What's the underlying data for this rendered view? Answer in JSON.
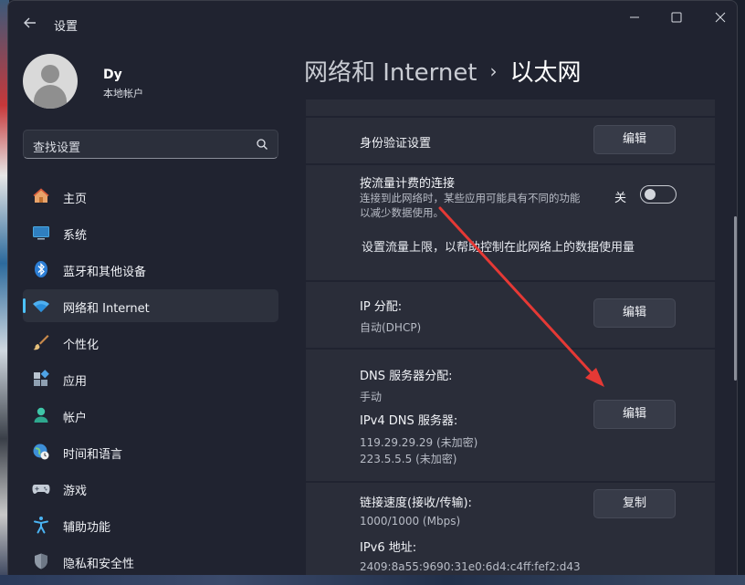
{
  "window": {
    "title": "设置"
  },
  "profile": {
    "name": "Dy",
    "account_type": "本地帐户"
  },
  "search": {
    "placeholder": "查找设置"
  },
  "nav": [
    {
      "label": "主页",
      "icon": "home-icon"
    },
    {
      "label": "系统",
      "icon": "monitor-icon"
    },
    {
      "label": "蓝牙和其他设备",
      "icon": "bluetooth-icon"
    },
    {
      "label": "网络和 Internet",
      "icon": "wifi-icon",
      "active": true
    },
    {
      "label": "个性化",
      "icon": "brush-icon"
    },
    {
      "label": "应用",
      "icon": "apps-icon"
    },
    {
      "label": "帐户",
      "icon": "account-icon"
    },
    {
      "label": "时间和语言",
      "icon": "globe-clock-icon"
    },
    {
      "label": "游戏",
      "icon": "gamepad-icon"
    },
    {
      "label": "辅助功能",
      "icon": "accessibility-icon"
    },
    {
      "label": "隐私和安全性",
      "icon": "shield-icon"
    }
  ],
  "breadcrumb": {
    "parent": "网络和 Internet",
    "separator": "›",
    "current": "以太网"
  },
  "auth": {
    "label": "身份验证设置",
    "button": "编辑"
  },
  "metered": {
    "label": "按流量计费的连接",
    "desc_line1": "连接到此网络时，某些应用可能具有不同的功能",
    "desc_line2": "以减少数据使用。",
    "toggle_state": "关",
    "toggle_on": false,
    "data_limit_link": "设置流量上限，以帮助控制在此网络上的数据使用量"
  },
  "ip": {
    "label": "IP 分配:",
    "value": "自动(DHCP)",
    "button": "编辑"
  },
  "dns": {
    "label": "DNS 服务器分配:",
    "value": "手动",
    "ipv4_label": "IPv4 DNS 服务器:",
    "server1": "119.29.29.29 (未加密)",
    "server2": "223.5.5.5 (未加密)",
    "button": "编辑"
  },
  "link": {
    "speed_label": "链接速度(接收/传输):",
    "speed_value": "1000/1000 (Mbps)",
    "ipv6_label": "IPv6 地址:",
    "ipv6_value": "2409:8a55:9690:31e0:6d4:c4ff:fef2:d43",
    "button": "复制"
  },
  "colors": {
    "accent": "#4cc2ff",
    "annotation_arrow": "#e53935",
    "window_bg": "#202330",
    "card_bg": "#2a2d39"
  }
}
